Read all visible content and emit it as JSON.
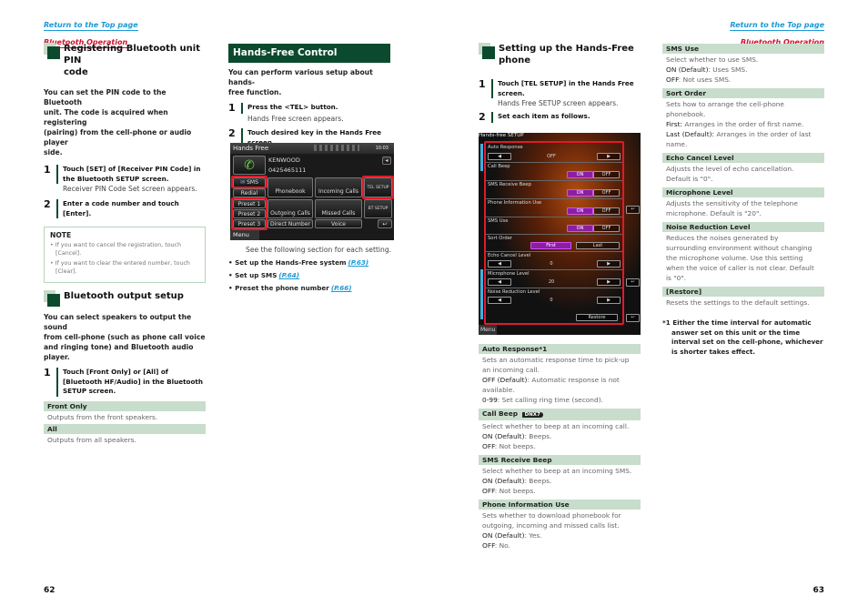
{
  "header": {
    "left": {
      "top_link": "Return to the Top page",
      "section_link": "Bluetooth Operation"
    },
    "right": {
      "top_link": "Return to the Top page",
      "section_link": "Bluetooth Operation"
    }
  },
  "col1": {
    "pin": {
      "title_line1": "Registering Bluetooth unit PIN",
      "title_line2": "code",
      "intro": [
        "You can set the PIN code to the Bluetooth",
        "unit. The code is acquired when registering",
        "(pairing) from the cell-phone or audio player",
        "side."
      ],
      "steps": [
        {
          "num": "1",
          "text": [
            "Touch [SET] of [Receiver PIN Code] in",
            "the Bluetooth SETUP screen."
          ],
          "sub": "Receiver PIN Code Set screen appears."
        },
        {
          "num": "2",
          "text": [
            "Enter a code number and touch",
            "[Enter]."
          ]
        }
      ],
      "note": {
        "title": "NOTE",
        "items": [
          "• If you want to cancel the registration, touch [Cancel].",
          "• If you want to clear the entered number, touch [Clear]."
        ]
      }
    },
    "output": {
      "title": "Bluetooth output setup",
      "intro": [
        "You can select speakers to output the sound",
        "from cell-phone (such as phone call voice",
        "and ringing tone) and Bluetooth audio",
        "player."
      ],
      "step": {
        "num": "1",
        "text": [
          "Touch [Front Only] or [All] of",
          "[Bluetooth HF/Audio] in the Bluetooth",
          "SETUP screen."
        ]
      },
      "table": [
        {
          "head": "Front Only",
          "body": "Outputs from the front speakers."
        },
        {
          "head": "All",
          "body": "Outputs from all speakers."
        }
      ]
    }
  },
  "col2": {
    "title": "Hands-Free Control",
    "intro": [
      "You can perform various setup about hands-",
      "free function."
    ],
    "steps": [
      {
        "num": "1",
        "text": [
          "Press the <TEL> button."
        ],
        "sub": "Hands Free screen appears."
      },
      {
        "num": "2",
        "text": [
          "Touch desired key in the Hands Free",
          "screen."
        ]
      }
    ],
    "screen": {
      "title": "Hands Free",
      "clock": "10:03",
      "device": "KENWOOD",
      "number": "0425465111",
      "buttons": {
        "sms": "SMS",
        "redial": "Redial",
        "phonebook": "Phonebook",
        "incoming": "Incoming Calls",
        "tel_setup": "TEL SETUP",
        "preset1": "Preset 1",
        "preset2": "Preset 2",
        "preset3": "Preset 3",
        "outgoing": "Outgoing Calls",
        "missed": "Missed Calls",
        "bt_setup": "BT SETUP",
        "direct": "Direct Number",
        "voice": "Voice",
        "menu": "Menu"
      }
    },
    "see_following": "See the following section for each setting.",
    "bullets": [
      {
        "text": "Set up the Hands-Free system",
        "link": "(P.63)"
      },
      {
        "text": "Set up SMS",
        "link": "(P.64)"
      },
      {
        "text": "Preset the phone number",
        "link": "(P.66)"
      }
    ]
  },
  "col3": {
    "title_line1": "Setting up the Hands-Free",
    "title_line2": "phone",
    "steps": [
      {
        "num": "1",
        "text": [
          "Touch [TEL SETUP] in the Hands Free",
          "screen."
        ],
        "sub": "Hands Free SETUP screen appears."
      },
      {
        "num": "2",
        "text": [
          "Set each item as follows."
        ]
      }
    ],
    "screen": {
      "title": "Hands-free SETUP",
      "menu": "Menu",
      "rows": [
        {
          "label": "Auto Response",
          "value": "OFF"
        },
        {
          "label": "Call Beep",
          "on": "ON",
          "off": "OFF"
        },
        {
          "label": "SMS Receive Beep",
          "on": "ON",
          "off": "OFF"
        },
        {
          "label": "Phone Information Use",
          "on": "ON",
          "off": "OFF"
        },
        {
          "label": "SMS Use",
          "on": "ON",
          "off": "OFF"
        },
        {
          "label": "Sort Order",
          "first": "First",
          "last": "Last"
        },
        {
          "label": "Echo Cancel Level",
          "value": "0"
        },
        {
          "label": "Microphone Level",
          "value": "20"
        },
        {
          "label": "Noise Reduction Level",
          "value": "0"
        }
      ],
      "restore": "Restore"
    },
    "table": [
      {
        "head": "Auto Response*1",
        "lines": [
          {
            "plain": "Sets an automatic response time to pick-up an incoming call."
          },
          {
            "key": "OFF (Default)",
            "val": ": Automatic response is not available."
          },
          {
            "key": "0-99",
            "val": ": Set calling ring time (second)."
          }
        ]
      },
      {
        "head": "Call Beep",
        "badge": "DNX7",
        "lines": [
          {
            "plain": "Select whether to beep at an incoming call."
          },
          {
            "key": "ON (Default)",
            "val": ": Beeps."
          },
          {
            "key": "OFF",
            "val": ": Not beeps."
          }
        ]
      },
      {
        "head": "SMS Receive Beep",
        "lines": [
          {
            "plain": "Select whether to beep at an incoming SMS."
          },
          {
            "key": "ON (Default)",
            "val": ": Beeps."
          },
          {
            "key": "OFF",
            "val": ": Not beeps."
          }
        ]
      },
      {
        "head": "Phone Information Use",
        "lines": [
          {
            "plain": "Sets whether to download phonebook for outgoing, incoming and missed calls list."
          },
          {
            "key": "ON (Default)",
            "val": ": Yes."
          },
          {
            "key": "OFF",
            "val": ": No."
          }
        ]
      }
    ]
  },
  "col4": {
    "table": [
      {
        "head": "SMS Use",
        "lines": [
          {
            "plain": "Select whether to use SMS."
          },
          {
            "key": "ON (Default)",
            "val": ": Uses SMS."
          },
          {
            "key": "OFF",
            "val": ": Not uses SMS."
          }
        ]
      },
      {
        "head": "Sort Order",
        "lines": [
          {
            "plain": "Sets how to arrange the cell-phone phonebook."
          },
          {
            "key": "First:",
            "val": " Arranges in the order of first name."
          },
          {
            "key": "Last (Default):",
            "val": " Arranges in the order of last name."
          }
        ]
      },
      {
        "head": "Echo Cancel Level",
        "lines": [
          {
            "plain": "Adjusts the level of echo cancellation."
          },
          {
            "plain": "Default is \"0\"."
          }
        ]
      },
      {
        "head": "Microphone Level",
        "lines": [
          {
            "plain": "Adjusts the sensitivity of the telephone microphone. Default is \"20\"."
          }
        ]
      },
      {
        "head": "Noise Reduction Level",
        "lines": [
          {
            "plain": "Reduces the noises generated by surrounding environment without changing the microphone volume. Use this setting when the voice of caller is not clear. Default is \"0\"."
          }
        ]
      },
      {
        "head": "[Restore]",
        "lines": [
          {
            "plain": "Resets the settings to the default settings."
          }
        ]
      }
    ],
    "footnote": "*1 Either the time interval for automatic answer set on this unit or the time interval set on the cell-phone, whichever is shorter takes effect."
  },
  "footer": {
    "left_page": "62",
    "right_page": "63"
  }
}
